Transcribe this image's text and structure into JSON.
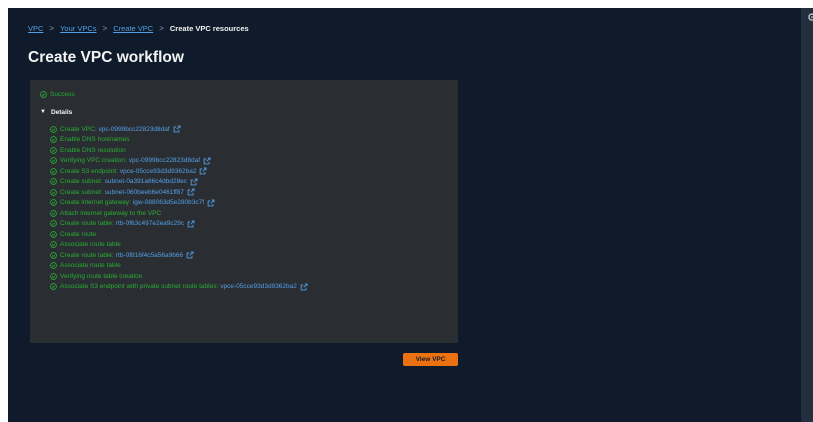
{
  "breadcrumb": {
    "items": [
      "VPC",
      "Your VPCs",
      "Create VPC"
    ],
    "current": "Create VPC resources",
    "separator": ">"
  },
  "page": {
    "title": "Create VPC workflow"
  },
  "status": {
    "label": "Success"
  },
  "details": {
    "toggle_label": "Details",
    "steps": [
      {
        "label": "Create VPC:",
        "link": "vpc-0999bcc22823d8daf"
      },
      {
        "label": "Enable DNS hostnames"
      },
      {
        "label": "Enable DNS resolution"
      },
      {
        "label": "Verifying VPC creation:",
        "link": "vpc-0999bcc22823d8daf"
      },
      {
        "label": "Create S3 endpoint:",
        "link": "vpce-05cce93d3d9362ba2"
      },
      {
        "label": "Create subnet:",
        "link": "subnet-0a391a66c4dbd28ec"
      },
      {
        "label": "Create subnet:",
        "link": "subnet-060beeb6e0461ff87"
      },
      {
        "label": "Create internet gateway:",
        "link": "igw-088063d5e280b3c7f"
      },
      {
        "label": "Attach internet gateway to the VPC"
      },
      {
        "label": "Create route table:",
        "link": "rtb-0f63c497e2ea9c29c"
      },
      {
        "label": "Create route"
      },
      {
        "label": "Associate route table"
      },
      {
        "label": "Create route table:",
        "link": "rtb-0f816f4c5a56a9b66"
      },
      {
        "label": "Associate route table"
      },
      {
        "label": "Verifying route table creation"
      },
      {
        "label": "Associate S3 endpoint with private subnet route tables:",
        "link": "vpce-05cce93d3d9362ba2"
      }
    ]
  },
  "actions": {
    "view_vpc_label": "View VPC"
  },
  "icons": {
    "success": "check-circle-icon",
    "external": "external-link-icon",
    "caret": "caret-down-icon",
    "settings": "gear-icon"
  },
  "colors": {
    "background": "#0f1b2a",
    "panel": "#2a2e33",
    "success": "#29ad32",
    "link": "#539fe5",
    "primary_button": "#ec7211"
  }
}
